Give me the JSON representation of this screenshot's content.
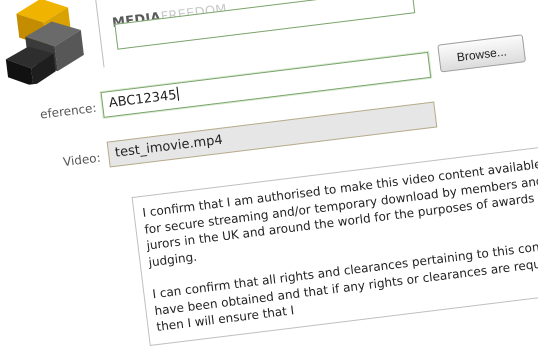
{
  "brand": {
    "part1": "MEDIA",
    "part2": "FREEDOM"
  },
  "form": {
    "top_input_value": "",
    "reference_label": "eference:",
    "reference_value": "ABC12345",
    "video_label": "Video:",
    "video_value": "test_imovie.mp4",
    "browse_label": "Browse..."
  },
  "declaration": {
    "paragraph1": "I confirm that I am authorised to make this video content available for secure streaming and/or temporary download by  members and jurors in the UK and around the world for the purposes of awards judging.",
    "paragraph2": "I can confirm that all rights and clearances pertaining to this content have been obtained and that if any rights or clearances are required then I will ensure that I"
  },
  "colors": {
    "accent_green_border": "#7aa36a",
    "logo_yellow": "#f0b400",
    "logo_dark": "#222222"
  }
}
